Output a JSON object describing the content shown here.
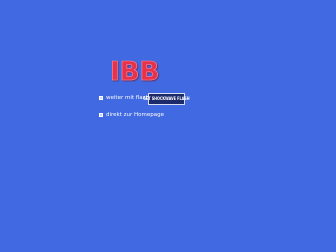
{
  "logo": {
    "text": "IBB",
    "color": "#e8304a"
  },
  "links": {
    "flash_label": "weiter mit flash",
    "homepage_label": "direkt zur Homepage"
  },
  "flash_badge": {
    "text": "GET SHOCKWAVE FLASH"
  }
}
